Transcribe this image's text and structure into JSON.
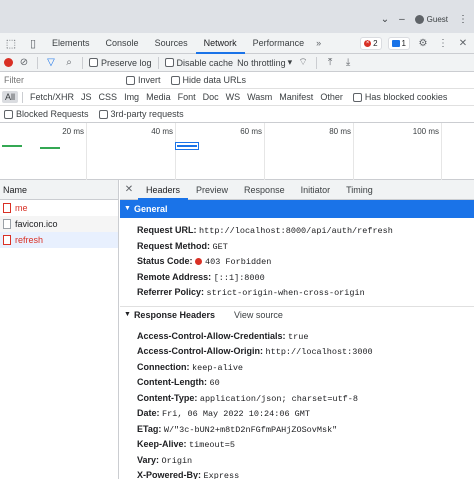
{
  "window": {
    "guest_label": "Guest"
  },
  "devtools": {
    "tabs": [
      "Elements",
      "Console",
      "Sources",
      "Network",
      "Performance"
    ],
    "active_tab": "Network",
    "error_count": "2",
    "message_count": "1"
  },
  "toolbar": {
    "preserve_log": "Preserve log",
    "disable_cache": "Disable cache",
    "throttle": "No throttling"
  },
  "filter": {
    "placeholder": "Filter",
    "invert": "Invert",
    "hide_data_urls": "Hide data URLs"
  },
  "types": [
    "All",
    "Fetch/XHR",
    "JS",
    "CSS",
    "Img",
    "Media",
    "Font",
    "Doc",
    "WS",
    "Wasm",
    "Manifest",
    "Other"
  ],
  "has_blocked_cookies": "Has blocked cookies",
  "blocked_requests": "Blocked Requests",
  "third_party": "3rd-party requests",
  "overview": {
    "ticks": [
      "20 ms",
      "40 ms",
      "60 ms",
      "80 ms",
      "100 ms"
    ]
  },
  "requests": {
    "header": "Name",
    "items": [
      {
        "name": "me",
        "status": "error"
      },
      {
        "name": "favicon.ico",
        "status": "ok"
      },
      {
        "name": "refresh",
        "status": "error"
      }
    ]
  },
  "detail": {
    "tabs": [
      "Headers",
      "Preview",
      "Response",
      "Initiator",
      "Timing"
    ],
    "active_tab": "Headers",
    "general": {
      "title": "General",
      "rows": [
        {
          "k": "Request URL:",
          "v": "http://localhost:8000/api/auth/refresh"
        },
        {
          "k": "Request Method:",
          "v": "GET"
        },
        {
          "k": "Status Code:",
          "v": "403 Forbidden"
        },
        {
          "k": "Remote Address:",
          "v": "[::1]:8000"
        },
        {
          "k": "Referrer Policy:",
          "v": "strict-origin-when-cross-origin"
        }
      ]
    },
    "response_headers": {
      "title": "Response Headers",
      "view_source": "View source",
      "rows": [
        {
          "k": "Access-Control-Allow-Credentials:",
          "v": "true"
        },
        {
          "k": "Access-Control-Allow-Origin:",
          "v": "http://localhost:3000"
        },
        {
          "k": "Connection:",
          "v": "keep-alive"
        },
        {
          "k": "Content-Length:",
          "v": "60"
        },
        {
          "k": "Content-Type:",
          "v": "application/json; charset=utf-8"
        },
        {
          "k": "Date:",
          "v": "Fri, 06 May 2022 10:24:06 GMT"
        },
        {
          "k": "ETag:",
          "v": "W/\"3c-bUN2+m8tD2nFGfmPAHjZOSovMsk\""
        },
        {
          "k": "Keep-Alive:",
          "v": "timeout=5"
        },
        {
          "k": "Vary:",
          "v": "Origin"
        },
        {
          "k": "X-Powered-By:",
          "v": "Express"
        }
      ]
    }
  }
}
